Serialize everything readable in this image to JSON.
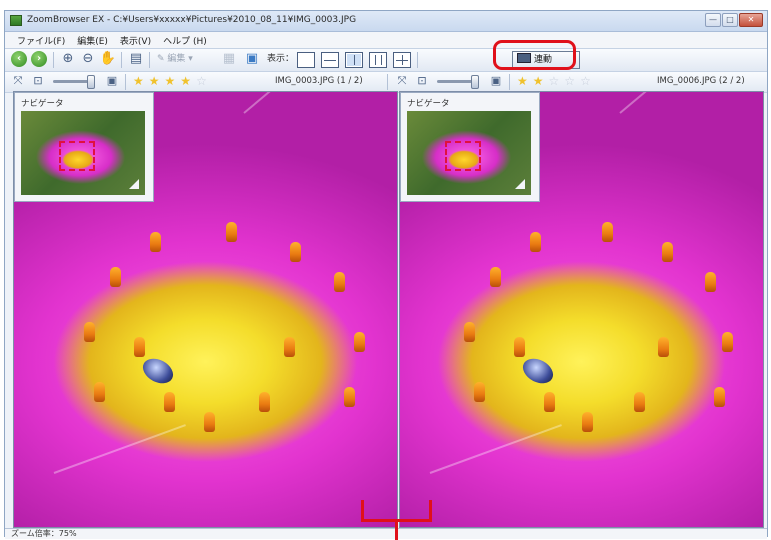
{
  "window": {
    "title": "ZoomBrowser EX - C:¥Users¥xxxxx¥Pictures¥2010_08_11¥IMG_0003.JPG",
    "controls": [
      "—",
      "□",
      "✕"
    ]
  },
  "menubar": {
    "items": [
      "ファイル(F)",
      "編集(E)",
      "表示(V)",
      "ヘルプ (H)"
    ]
  },
  "toolbar": {
    "edit_label": "編集",
    "display_label": "表示：",
    "sync_label": "連動"
  },
  "left_pane": {
    "filename": "IMG_0003.JPG (1 / 2)",
    "rating": 4,
    "navigator_label": "ナビゲータ"
  },
  "right_pane": {
    "filename": "IMG_0006.JPG (2 / 2)",
    "rating": 2,
    "navigator_label": "ナビゲータ"
  },
  "statusbar": {
    "zoom_text": "ズーム倍率：75%"
  },
  "colors": {
    "highlight": "#e0101a",
    "petal": "#e233cf",
    "center": "#f4dd2b"
  }
}
